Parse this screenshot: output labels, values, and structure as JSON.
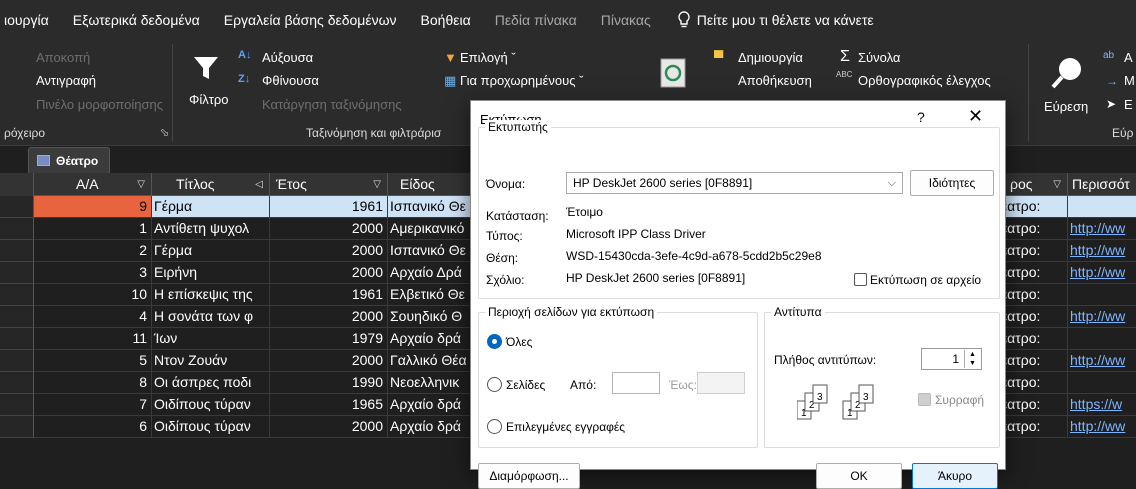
{
  "menu": {
    "items": [
      {
        "label": "ιουργία",
        "dim": false
      },
      {
        "label": "Εξωτερικά δεδομένα",
        "dim": false
      },
      {
        "label": "Εργαλεία βάσης δεδομένων",
        "dim": false
      },
      {
        "label": "Βοήθεια",
        "dim": false
      },
      {
        "label": "Πεδία πίνακα",
        "dim": true
      },
      {
        "label": "Πίνακας",
        "dim": true
      }
    ],
    "tell_me": "Πείτε μου τι θέλετε να κάνετε"
  },
  "ribbon": {
    "clipboard": {
      "cut": "Αποκοπή",
      "copy": "Αντιγραφή",
      "format_painter": "Πινέλο μορφοποίησης",
      "group": "ρόχειρο"
    },
    "sort": {
      "filter": "Φίλτρο",
      "asc": "Αύξουσα",
      "desc": "Φθίνουσα",
      "clear": "Κατάργηση ταξινόμησης",
      "selection": "Επιλογή ˇ",
      "advanced": "Για προχωρημένους ˇ",
      "group": "Ταξινόμηση και φιλτράρισ"
    },
    "records": {
      "create": "Δημιουργία",
      "save": "Αποθήκευση",
      "totals": "Σύνολα",
      "spelling": "Ορθογραφικός έλεγχος"
    },
    "find": {
      "find": "Εύρεση",
      "group": "Εύρ",
      "a": "Α",
      "m": "Μ",
      "e": "Ε"
    }
  },
  "datasheet": {
    "tab": "Θέατρο",
    "headers": {
      "aa": "Α/Α",
      "title": "Τίτλος",
      "year": "Έτος",
      "genre": "Είδος",
      "place": "ρος",
      "desc": "Περισσότ"
    },
    "rows": [
      {
        "aa": "9",
        "title": "Γέρμα",
        "year": "1961",
        "genre": "Ισπανικό Θε",
        "place": "Θέατρο:",
        "link": ""
      },
      {
        "aa": "1",
        "title": "Αντίθετη ψυχολ",
        "year": "2000",
        "genre": "Αμερικανικό",
        "place": "Θέατρο:",
        "link": "http://ww"
      },
      {
        "aa": "2",
        "title": "Γέρμα",
        "year": "2000",
        "genre": "Ισπανικό Θε",
        "place": "Θέατρο:",
        "link": "http://ww"
      },
      {
        "aa": "3",
        "title": "Ειρήνη",
        "year": "2000",
        "genre": "Αρχαίο Δρά",
        "place": "Θέατρο:",
        "link": "http://ww"
      },
      {
        "aa": "10",
        "title": "Η επίσκεψις της",
        "year": "1961",
        "genre": "Ελβετικό Θε",
        "place": "Θέατρο:",
        "link": ""
      },
      {
        "aa": "4",
        "title": "Η σονάτα των φ",
        "year": "2000",
        "genre": "Σουηδικό Θ",
        "place": "Θέατρο:",
        "link": "http://ww"
      },
      {
        "aa": "11",
        "title": "Ίων",
        "year": "1979",
        "genre": "Αρχαίο δρά",
        "place": "Θέατρο:",
        "link": ""
      },
      {
        "aa": "5",
        "title": "Ντον Ζουάν",
        "year": "2000",
        "genre": "Γαλλικό Θέα",
        "place": "Θέατρο:",
        "link": "http://ww"
      },
      {
        "aa": "8",
        "title": "Οι άσπρες ποδι",
        "year": "1990",
        "genre": "Νεοελληνικ",
        "place": "Θέατρο:",
        "link": ""
      },
      {
        "aa": "7",
        "title": "Οιδίπους τύραν",
        "year": "1965",
        "genre": "Αρχαίο δρά",
        "place": "Θέατρο:",
        "link": "https://w"
      },
      {
        "aa": "6",
        "title": "Οιδίπους τύραν",
        "year": "2000",
        "genre": "Αρχαίο δρά",
        "place": "Θέατρο:",
        "link": "http://ww"
      }
    ]
  },
  "dialog": {
    "title": "Εκτύπωση",
    "help": "?",
    "close": "✕",
    "printer": {
      "legend": "Εκτυπωτής",
      "name_label": "Όνομα:",
      "name_value": "HP DeskJet 2600 series [0F8891]",
      "properties": "Ιδιότητες",
      "status_label": "Κατάσταση:",
      "status_value": "Έτοιμο",
      "type_label": "Τύπος:",
      "type_value": "Microsoft IPP Class Driver",
      "where_label": "Θέση:",
      "where_value": "WSD-15430cda-3efe-4c9d-a678-5cdd2b5c29e8",
      "comment_label": "Σχόλιο:",
      "comment_value": "HP DeskJet 2600 series [0F8891]",
      "print_to_file": "Εκτύπωση σε αρχείο"
    },
    "range": {
      "legend": "Περιοχή σελίδων για εκτύπωση",
      "all": "Όλες",
      "pages": "Σελίδες",
      "from": "Από:",
      "to": "Έως:",
      "selected": "Επιλεγμένες εγγραφές"
    },
    "copies": {
      "legend": "Αντίτυπα",
      "count_label": "Πλήθος αντιτύπων:",
      "count": "1",
      "collate": "Συρραφή"
    },
    "setup": "Διαμόρφωση...",
    "ok": "OK",
    "cancel": "Άκυρο"
  },
  "colors": {
    "accent": "#0078d4",
    "selected_row": "#cfe3f7",
    "current_cell": "#e8643e",
    "link": "#7fb5ff"
  }
}
